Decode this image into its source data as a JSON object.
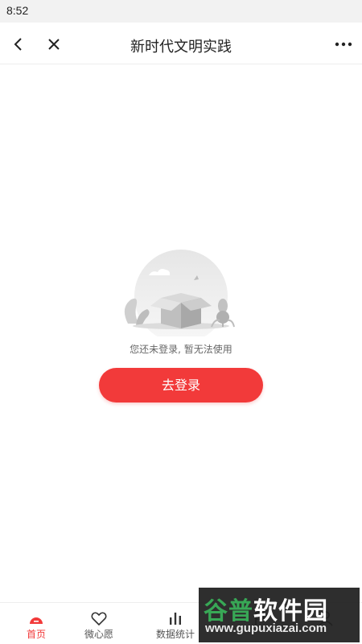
{
  "status_bar": {
    "time": "8:52"
  },
  "nav": {
    "title": "新时代文明实践",
    "back_icon": "chevron-left-icon",
    "close_icon": "close-icon",
    "more_icon": "more-horizontal-icon"
  },
  "empty_state": {
    "illustration": "empty-box-icon",
    "message": "您还未登录, 暂无法使用",
    "login_button": "去登录"
  },
  "tabs": [
    {
      "label": "首页",
      "icon": "home-icon",
      "active": true
    },
    {
      "label": "微心愿",
      "icon": "heart-icon",
      "active": false
    },
    {
      "label": "数据统计",
      "icon": "bar-chart-icon",
      "active": false
    },
    {
      "label": "",
      "icon": "flag-icon",
      "active": false
    },
    {
      "label": "",
      "icon": "user-icon",
      "active": false
    }
  ],
  "watermark": {
    "brand_green": "谷普",
    "brand_white": "软件园",
    "url": "www.gupuxiazai.com"
  },
  "colors": {
    "accent": "#f23a3a",
    "watermark_green": "#2aa24a"
  }
}
